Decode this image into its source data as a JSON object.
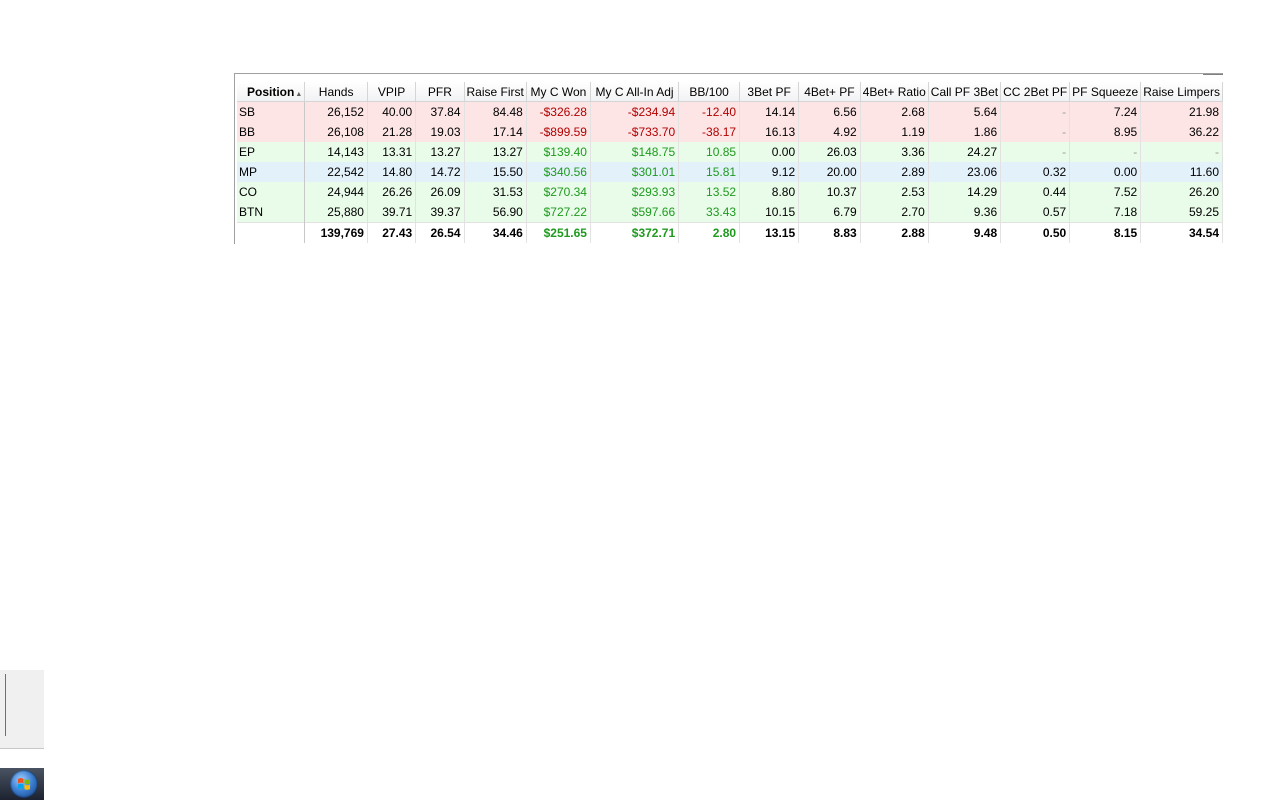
{
  "table": {
    "sort_column": "Position",
    "columns": [
      "Position",
      "Hands",
      "VPIP",
      "PFR",
      "Raise First",
      "My C Won",
      "My C All-In Adj",
      "BB/100",
      "3Bet PF",
      "4Bet+ PF",
      "4Bet+ Ratio",
      "Call PF 3Bet",
      "CC 2Bet PF",
      "PF Squeeze",
      "Raise Limpers"
    ],
    "rows": [
      {
        "position": "SB",
        "hands": "26,152",
        "vpip": "40.00",
        "pfr": "37.84",
        "raise_first": "84.48",
        "c_won": "-$326.28",
        "allin_adj": "-$234.94",
        "bb100": "-12.40",
        "threebet": "14.14",
        "fourbet": "6.56",
        "fourbet_ratio": "2.68",
        "call_3bet": "5.64",
        "cc_2bet": "-",
        "squeeze": "7.24",
        "raise_limpers": "21.98"
      },
      {
        "position": "BB",
        "hands": "26,108",
        "vpip": "21.28",
        "pfr": "19.03",
        "raise_first": "17.14",
        "c_won": "-$899.59",
        "allin_adj": "-$733.70",
        "bb100": "-38.17",
        "threebet": "16.13",
        "fourbet": "4.92",
        "fourbet_ratio": "1.19",
        "call_3bet": "1.86",
        "cc_2bet": "-",
        "squeeze": "8.95",
        "raise_limpers": "36.22"
      },
      {
        "position": "EP",
        "hands": "14,143",
        "vpip": "13.31",
        "pfr": "13.27",
        "raise_first": "13.27",
        "c_won": "$139.40",
        "allin_adj": "$148.75",
        "bb100": "10.85",
        "threebet": "0.00",
        "fourbet": "26.03",
        "fourbet_ratio": "3.36",
        "call_3bet": "24.27",
        "cc_2bet": "-",
        "squeeze": "-",
        "raise_limpers": "-"
      },
      {
        "position": "MP",
        "hands": "22,542",
        "vpip": "14.80",
        "pfr": "14.72",
        "raise_first": "15.50",
        "c_won": "$340.56",
        "allin_adj": "$301.01",
        "bb100": "15.81",
        "threebet": "9.12",
        "fourbet": "20.00",
        "fourbet_ratio": "2.89",
        "call_3bet": "23.06",
        "cc_2bet": "0.32",
        "squeeze": "0.00",
        "raise_limpers": "11.60"
      },
      {
        "position": "CO",
        "hands": "24,944",
        "vpip": "26.26",
        "pfr": "26.09",
        "raise_first": "31.53",
        "c_won": "$270.34",
        "allin_adj": "$293.93",
        "bb100": "13.52",
        "threebet": "8.80",
        "fourbet": "10.37",
        "fourbet_ratio": "2.53",
        "call_3bet": "14.29",
        "cc_2bet": "0.44",
        "squeeze": "7.52",
        "raise_limpers": "26.20"
      },
      {
        "position": "BTN",
        "hands": "25,880",
        "vpip": "39.71",
        "pfr": "39.37",
        "raise_first": "56.90",
        "c_won": "$727.22",
        "allin_adj": "$597.66",
        "bb100": "33.43",
        "threebet": "10.15",
        "fourbet": "6.79",
        "fourbet_ratio": "2.70",
        "call_3bet": "9.36",
        "cc_2bet": "0.57",
        "squeeze": "7.18",
        "raise_limpers": "59.25"
      }
    ],
    "totals": {
      "position": "",
      "hands": "139,769",
      "vpip": "27.43",
      "pfr": "26.54",
      "raise_first": "34.46",
      "c_won": "$251.65",
      "allin_adj": "$372.71",
      "bb100": "2.80",
      "threebet": "13.15",
      "fourbet": "8.83",
      "fourbet_ratio": "2.88",
      "call_3bet": "9.48",
      "cc_2bet": "0.50",
      "squeeze": "8.15",
      "raise_limpers": "34.54"
    }
  },
  "colors": {
    "negative_row": "#fde5e6",
    "positive_row": "#e9fbe9",
    "neutral_row": "#e3f1fb",
    "money_negative": "#b30000",
    "money_positive": "#1f9a1f"
  },
  "icons": {
    "start_button": "windows-start-orb-icon",
    "sort": "sort-ascending-icon"
  }
}
